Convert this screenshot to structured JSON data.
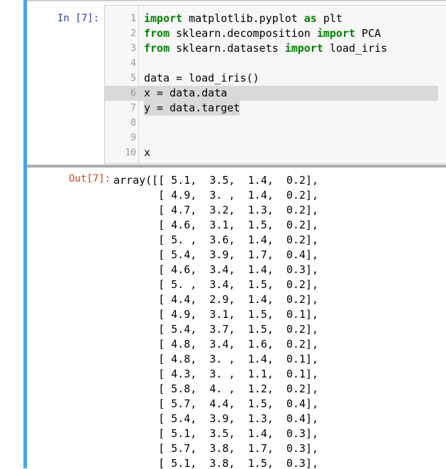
{
  "input_prompt": "In [7]:",
  "output_prompt": "Out[7]:",
  "code_lines": [
    {
      "num": "1",
      "parts": [
        {
          "t": "import",
          "kw": true
        },
        {
          "t": " matplotlib.pyplot ",
          "kw": false
        },
        {
          "t": "as",
          "kw": true
        },
        {
          "t": " plt",
          "kw": false
        }
      ]
    },
    {
      "num": "2",
      "parts": [
        {
          "t": "from",
          "kw": true
        },
        {
          "t": " sklearn.decomposition ",
          "kw": false
        },
        {
          "t": "import",
          "kw": true
        },
        {
          "t": " PCA",
          "kw": false
        }
      ]
    },
    {
      "num": "3",
      "parts": [
        {
          "t": "from",
          "kw": true
        },
        {
          "t": " sklearn.datasets ",
          "kw": false
        },
        {
          "t": "import",
          "kw": true
        },
        {
          "t": " load_iris",
          "kw": false
        }
      ]
    },
    {
      "num": "4",
      "parts": []
    },
    {
      "num": "5",
      "parts": [
        {
          "t": "data = load_iris()",
          "kw": false
        }
      ]
    },
    {
      "num": "6",
      "parts": [
        {
          "t": "x = data.data",
          "kw": false
        }
      ],
      "highlight": "full"
    },
    {
      "num": "7",
      "parts": [
        {
          "t": "y = data.target",
          "kw": false
        }
      ],
      "highlight": "text"
    },
    {
      "num": "8",
      "parts": []
    },
    {
      "num": "9",
      "parts": []
    },
    {
      "num": "10",
      "parts": [
        {
          "t": "x",
          "kw": false
        }
      ]
    }
  ],
  "output_lines": [
    "array([[ 5.1,  3.5,  1.4,  0.2],",
    "       [ 4.9,  3. ,  1.4,  0.2],",
    "       [ 4.7,  3.2,  1.3,  0.2],",
    "       [ 4.6,  3.1,  1.5,  0.2],",
    "       [ 5. ,  3.6,  1.4,  0.2],",
    "       [ 5.4,  3.9,  1.7,  0.4],",
    "       [ 4.6,  3.4,  1.4,  0.3],",
    "       [ 5. ,  3.4,  1.5,  0.2],",
    "       [ 4.4,  2.9,  1.4,  0.2],",
    "       [ 4.9,  3.1,  1.5,  0.1],",
    "       [ 5.4,  3.7,  1.5,  0.2],",
    "       [ 4.8,  3.4,  1.6,  0.2],",
    "       [ 4.8,  3. ,  1.4,  0.1],",
    "       [ 4.3,  3. ,  1.1,  0.1],",
    "       [ 5.8,  4. ,  1.2,  0.2],",
    "       [ 5.7,  4.4,  1.5,  0.4],",
    "       [ 5.4,  3.9,  1.3,  0.4],",
    "       [ 5.1,  3.5,  1.4,  0.3],",
    "       [ 5.7,  3.8,  1.7,  0.3],",
    "       [ 5.1,  3.8,  1.5,  0.3],"
  ],
  "colors": {
    "cell_border": "#42a5f5",
    "keyword": "#008000",
    "in_prompt": "#303f9f",
    "out_prompt": "#d84315"
  }
}
